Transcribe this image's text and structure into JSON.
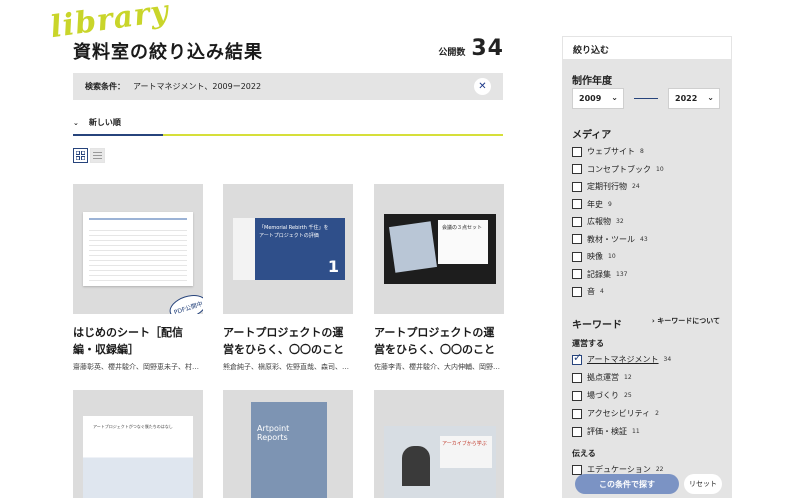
{
  "brand": {
    "logo_text": "library",
    "logo_color": "#c9d52a",
    "accent_color": "#27447c"
  },
  "header": {
    "title": "資料室の絞り込み結果",
    "count_label": "公開数",
    "count": "34"
  },
  "search_condition": {
    "label": "検索条件：",
    "value": "アートマネジメント、2009ー2022",
    "clear_icon": "close-icon"
  },
  "sort": {
    "label": "新しい順",
    "icon": "chevron-down-icon"
  },
  "view": {
    "grid_icon": "grid-view-icon",
    "list_icon": "list-view-icon",
    "active": "grid"
  },
  "cards": [
    {
      "title": "はじめのシート［配信編・収録編］",
      "authors": "齋藤彰英、櫻井駿介、岡野恵未子、村田萌菜",
      "badge": "PDF公開中"
    },
    {
      "title": "アートプロジェクトの運営をひらく、〇〇のことば。［評価の…",
      "authors": "熊倉純子、槇原彩、佐野直哉、森司、吉田武…",
      "thumb_text": "「Memorial Rebirth 千住」を\nアートプロジェクトの評価",
      "thumb_num": "1"
    },
    {
      "title": "アートプロジェクトの運営をひらく、〇〇のことば。［評価の…",
      "authors": "佐藤李青、櫻井駿介、大内伸輔、岡野恵未子…",
      "thumb_text": "会議の３点セット"
    },
    {
      "title": "",
      "authors": "",
      "thumb_text": "アートプロジェクトがつなぐ僕たちのはなし"
    },
    {
      "title": "",
      "authors": "",
      "thumb_text": "Artpoint Reports"
    },
    {
      "title": "",
      "authors": "",
      "thumb_text": "アーカイブから学ぶ"
    }
  ],
  "sidebar": {
    "heading": "絞り込む",
    "year": {
      "label": "制作年度",
      "from": "2009",
      "to": "2022"
    },
    "media": {
      "label": "メディア",
      "items": [
        {
          "label": "ウェブサイト",
          "count": "8",
          "checked": false
        },
        {
          "label": "コンセプトブック",
          "count": "10",
          "checked": false
        },
        {
          "label": "定期刊行物",
          "count": "24",
          "checked": false
        },
        {
          "label": "年史",
          "count": "9",
          "checked": false
        },
        {
          "label": "広報物",
          "count": "32",
          "checked": false
        },
        {
          "label": "教材・ツール",
          "count": "43",
          "checked": false
        },
        {
          "label": "映像",
          "count": "10",
          "checked": false
        },
        {
          "label": "記録集",
          "count": "137",
          "checked": false
        },
        {
          "label": "音",
          "count": "4",
          "checked": false
        }
      ]
    },
    "keyword": {
      "label": "キーワード",
      "about_link": "キーワードについて",
      "group1": "運営する",
      "items": [
        {
          "label": "アートマネジメント",
          "count": "34",
          "checked": true
        },
        {
          "label": "拠点運営",
          "count": "12",
          "checked": false
        },
        {
          "label": "場づくり",
          "count": "25",
          "checked": false
        },
        {
          "label": "アクセシビリティ",
          "count": "2",
          "checked": false
        },
        {
          "label": "評価・検証",
          "count": "11",
          "checked": false
        }
      ],
      "group2": "伝える",
      "items2": [
        {
          "label": "エデュケーション",
          "count": "22",
          "checked": false
        }
      ]
    },
    "search_button": "この条件で探す",
    "reset_button": "リセット"
  }
}
